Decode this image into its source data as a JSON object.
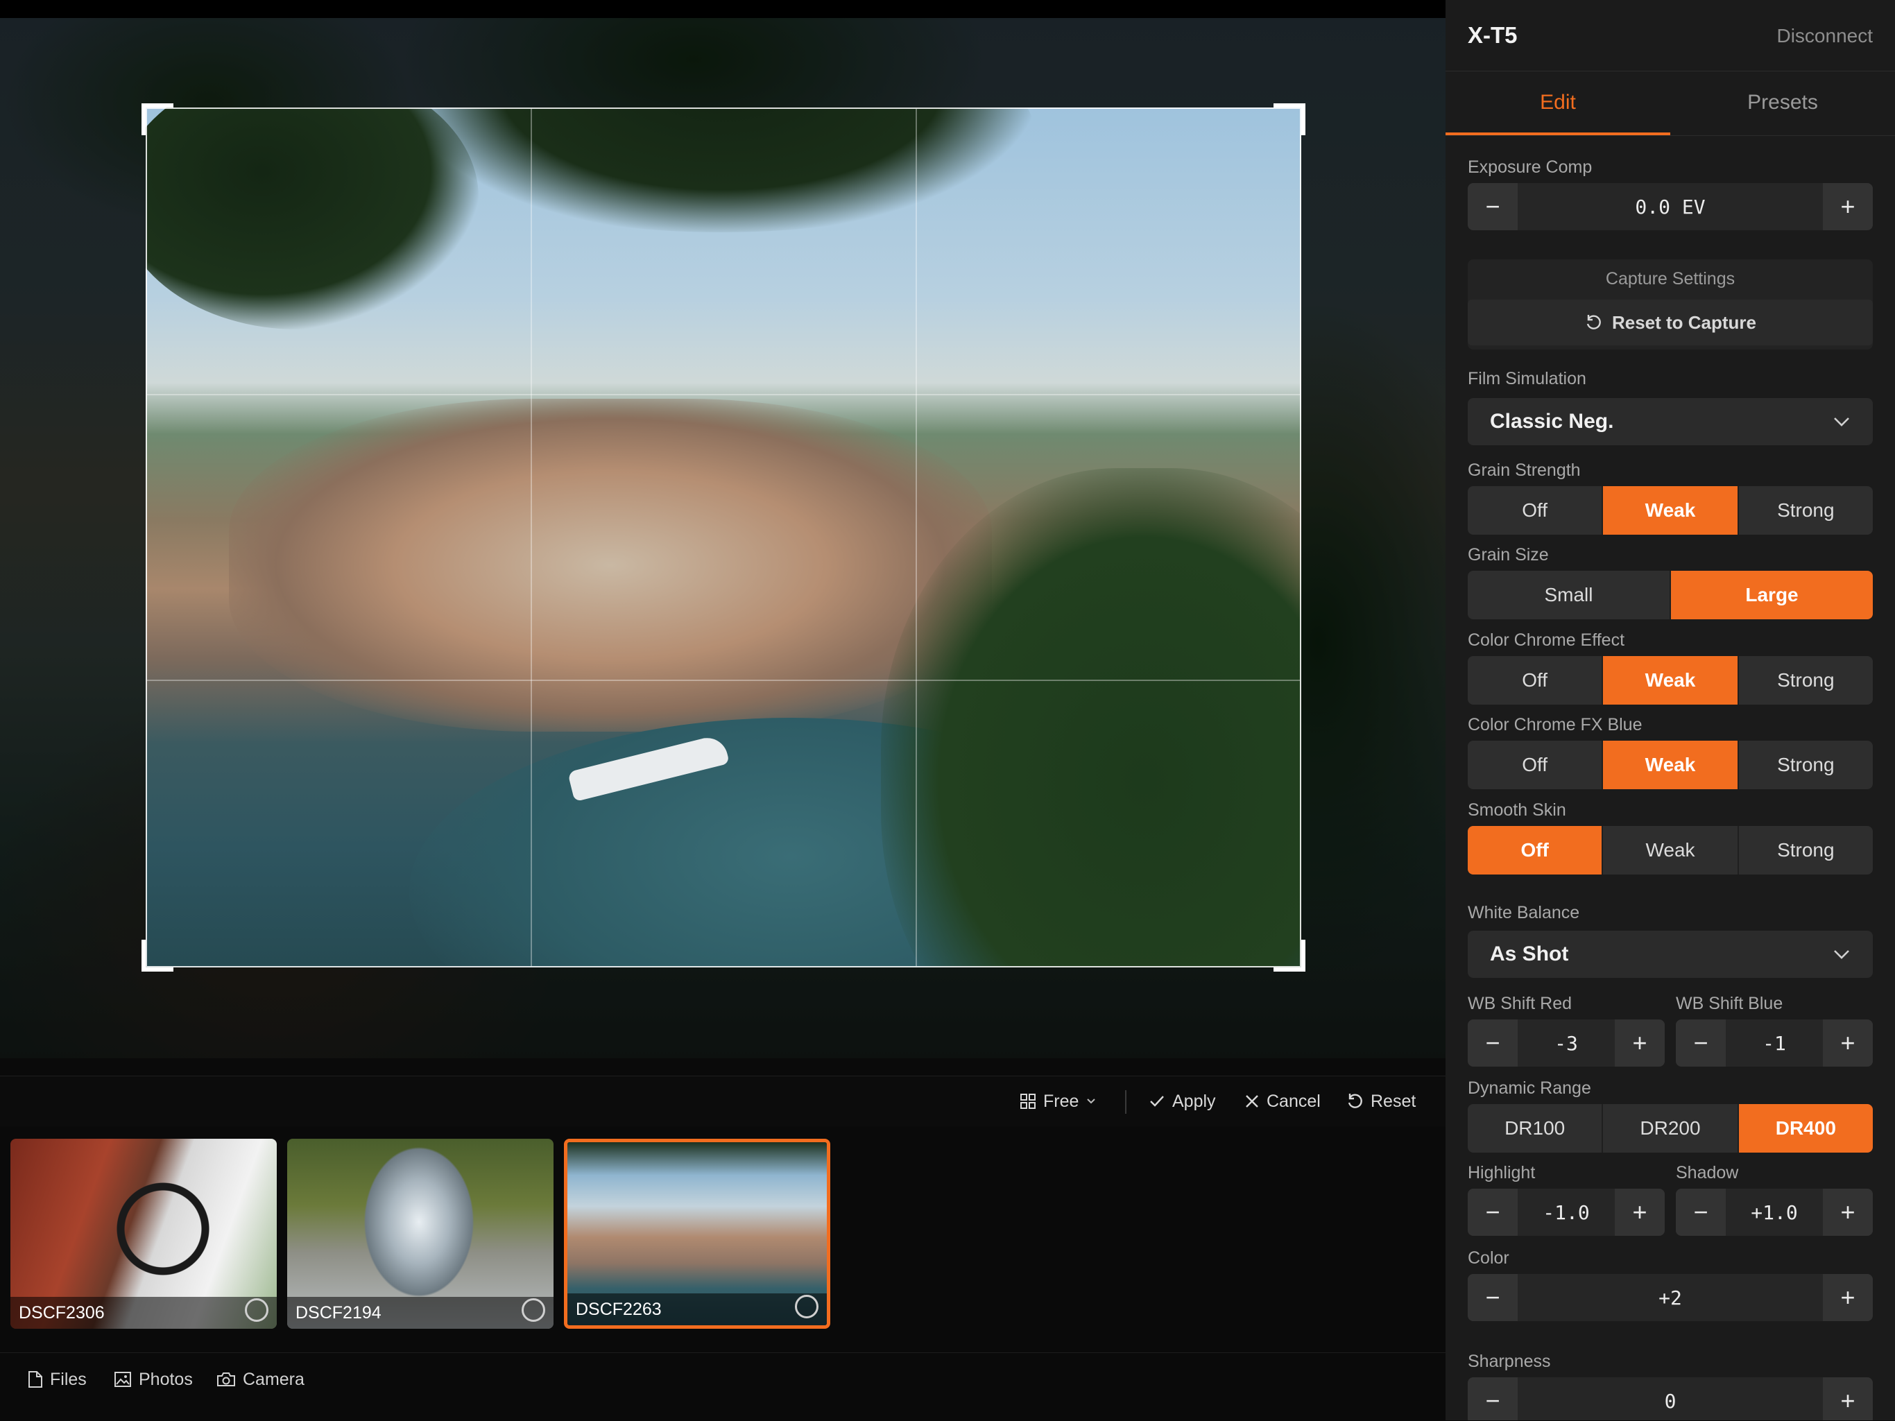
{
  "crop_toolbar": {
    "aspect_label": "Free",
    "apply_label": "Apply",
    "cancel_label": "Cancel",
    "reset_label": "Reset"
  },
  "filmstrip": [
    {
      "name": "DSCF2306",
      "selected": false
    },
    {
      "name": "DSCF2194",
      "selected": false
    },
    {
      "name": "DSCF2263",
      "selected": true
    }
  ],
  "bottom_nav": {
    "files": "Files",
    "photos": "Photos",
    "camera": "Camera"
  },
  "panel": {
    "camera_name": "X-T5",
    "disconnect": "Disconnect",
    "tabs": [
      "Edit",
      "Presets"
    ],
    "active_tab": "Edit",
    "exposure": {
      "label": "Exposure Comp",
      "value": "0.0 EV"
    },
    "capture": {
      "title": "Capture Settings",
      "reset_label": "Reset to Capture"
    },
    "film_sim": {
      "label": "Film Simulation",
      "value": "Classic Neg."
    },
    "grain_strength": {
      "label": "Grain Strength",
      "options": [
        "Off",
        "Weak",
        "Strong"
      ],
      "selected": "Weak"
    },
    "grain_size": {
      "label": "Grain Size",
      "options": [
        "Small",
        "Large"
      ],
      "selected": "Large"
    },
    "color_chrome": {
      "label": "Color Chrome Effect",
      "options": [
        "Off",
        "Weak",
        "Strong"
      ],
      "selected": "Weak"
    },
    "color_chrome_blue": {
      "label": "Color Chrome FX Blue",
      "options": [
        "Off",
        "Weak",
        "Strong"
      ],
      "selected": "Weak"
    },
    "smooth_skin": {
      "label": "Smooth Skin",
      "options": [
        "Off",
        "Weak",
        "Strong"
      ],
      "selected": "Off"
    },
    "white_balance": {
      "label": "White Balance",
      "value": "As Shot"
    },
    "wb_shift_red": {
      "label": "WB Shift Red",
      "value": "-3"
    },
    "wb_shift_blue": {
      "label": "WB Shift Blue",
      "value": "-1"
    },
    "dynamic_range": {
      "label": "Dynamic Range",
      "options": [
        "DR100",
        "DR200",
        "DR400"
      ],
      "selected": "DR400"
    },
    "highlight": {
      "label": "Highlight",
      "value": "-1.0"
    },
    "shadow": {
      "label": "Shadow",
      "value": "+1.0"
    },
    "color": {
      "label": "Color",
      "value": "+2"
    },
    "sharpness": {
      "label": "Sharpness",
      "value": "0"
    }
  },
  "colors": {
    "accent": "#f26d1f",
    "panel_bg": "#1b1b1b"
  },
  "icons": {
    "minus": "−",
    "plus": "+"
  }
}
